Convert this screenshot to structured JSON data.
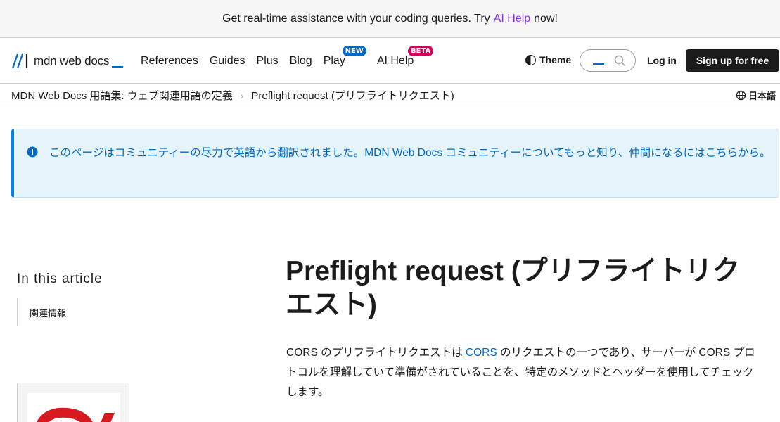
{
  "banner": {
    "text_before": "Get real-time assistance with your coding queries. Try",
    "link": "AI Help",
    "text_after": "now!"
  },
  "header": {
    "logo_text": "mdn web docs",
    "nav": [
      {
        "label": "References"
      },
      {
        "label": "Guides"
      },
      {
        "label": "Plus"
      },
      {
        "label": "Blog"
      },
      {
        "label": "Play",
        "badge": "NEW"
      },
      {
        "label": "AI Help",
        "badge": "BETA"
      }
    ],
    "theme_label": "Theme",
    "login_label": "Log in",
    "signup_label": "Sign up for free"
  },
  "breadcrumb": {
    "items": [
      "MDN Web Docs 用語集: ウェブ関連用語の定義",
      "Preflight request (プリフライトリクエスト)"
    ],
    "language": "日本語"
  },
  "notice": {
    "text": "このページはコミュニティーの尽力で英語から翻訳されました。MDN Web Docs コミュニティーについてもっと知り、仲間になるにはこちらから。"
  },
  "toc": {
    "title": "In this article",
    "items": [
      "関連情報"
    ]
  },
  "article": {
    "title": "Preflight request (プリフライトリクエスト)",
    "para_before": "CORS のプリフライトリクエストは",
    "para_link": "CORS",
    "para_after": "のリクエストの一つであり、サーバーが CORS プロトコルを理解していて準備がされていることを、特定のメソッドとヘッダーを使用してチェックします。"
  },
  "colors": {
    "accent": "#0069c2",
    "ai_help": "#8a36e0",
    "badge_new": "#0069c2",
    "badge_beta": "#d3005b",
    "notice_bg": "#e5f4fb"
  }
}
